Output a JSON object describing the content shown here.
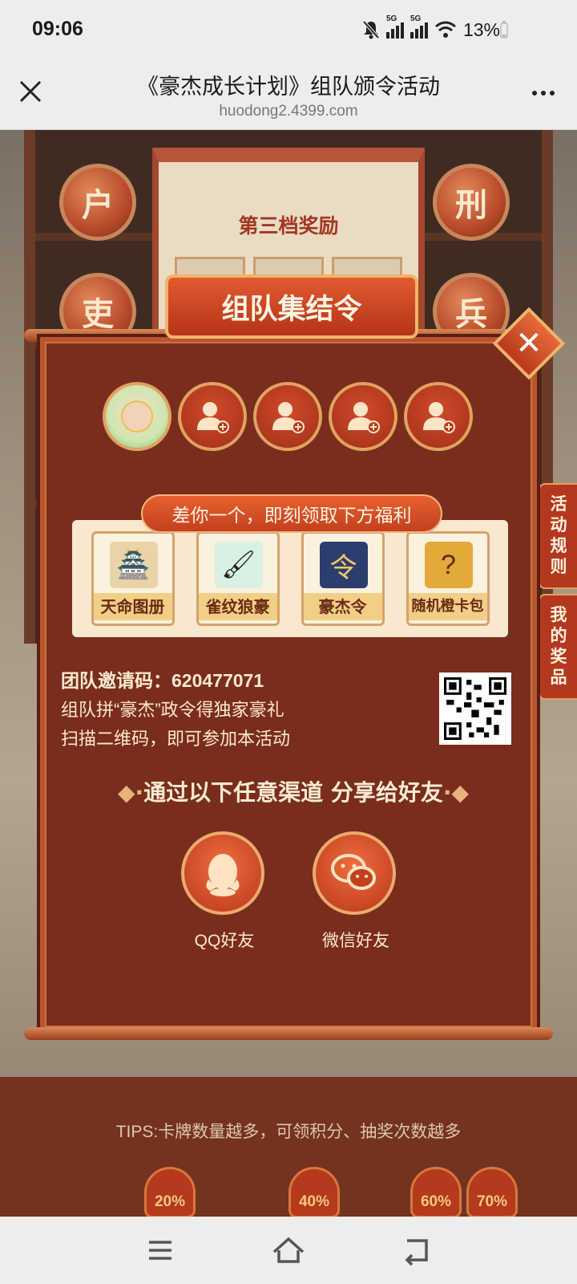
{
  "status": {
    "time": "09:06",
    "net1": "5G",
    "net2": "5G",
    "battery": "13%"
  },
  "browser": {
    "title": "《豪杰成长计划》组队颁令活动",
    "url": "huodong2.4399.com"
  },
  "background": {
    "scroll_label": "第三档奖励",
    "seals": [
      "户",
      "刑",
      "吏",
      "兵"
    ],
    "side_tabs": [
      "活动规则",
      "我的奖品"
    ]
  },
  "modal": {
    "title": "组队集结令",
    "close_glyph": "✕",
    "tip": "差你一个，即刻领取下方福利",
    "rewards": [
      {
        "name": "天命图册",
        "icon": "pagoda-scroll-icon"
      },
      {
        "name": "雀纹狼豪",
        "icon": "brush-icon"
      },
      {
        "name": "豪杰令",
        "icon": "token-icon"
      },
      {
        "name": "随机橙卡包",
        "icon": "card-pack-icon"
      }
    ],
    "invite_label": "团队邀请码：",
    "invite_code": "620477071",
    "line2": "组队拼“豪杰”政令得独家豪礼",
    "line3": "扫描二维码，即可参加本活动",
    "share_title": "通过以下任意渠道 分享给好友",
    "share": [
      {
        "label": "QQ好友",
        "icon": "qq-icon"
      },
      {
        "label": "微信好友",
        "icon": "wechat-icon"
      }
    ]
  },
  "tips": "TIPS:卡牌数量越多，可领积分、抽奖次数越多",
  "progress": [
    "20%",
    "40%",
    "60%",
    "70%"
  ],
  "colors": {
    "modal": "#7a2d1c",
    "accent": "#e25a2f",
    "gold": "#e0a35f"
  }
}
